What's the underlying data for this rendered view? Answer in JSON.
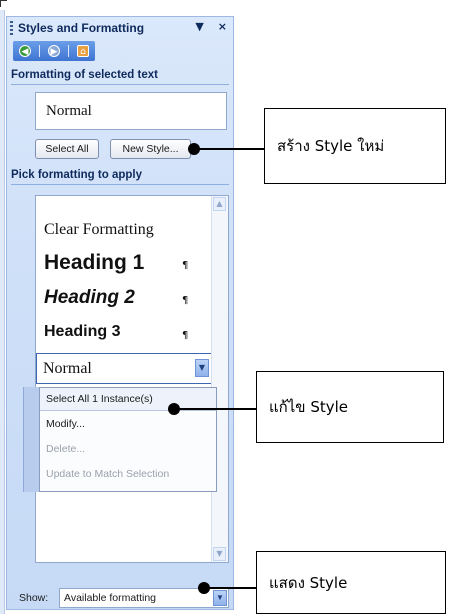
{
  "pane": {
    "title": "Styles and Formatting",
    "title_buttons": [
      "▼",
      "×"
    ],
    "nav_icons": [
      "back-icon",
      "forward-icon",
      "home-icon"
    ]
  },
  "formatting_selected": {
    "heading": "Formatting of selected text",
    "value": "Normal"
  },
  "buttons": {
    "select_all": "Select All",
    "new_style": "New Style..."
  },
  "pick_formatting": {
    "heading": "Pick formatting to apply",
    "items": [
      {
        "label": "Clear Formatting",
        "pilcrow": ""
      },
      {
        "label": "Heading 1",
        "pilcrow": "¶"
      },
      {
        "label": "Heading 2",
        "pilcrow": "¶"
      },
      {
        "label": "Heading 3",
        "pilcrow": "¶"
      },
      {
        "label": "Normal",
        "pilcrow": ""
      }
    ]
  },
  "context_menu": {
    "items": [
      {
        "label": "Select All 1 Instance(s)",
        "disabled": false
      },
      {
        "label": "Modify...",
        "disabled": false
      },
      {
        "label": "Delete...",
        "disabled": true
      },
      {
        "label": "Update to Match Selection",
        "disabled": true
      }
    ]
  },
  "show": {
    "label": "Show:",
    "value": "Available formatting"
  },
  "callouts": {
    "new_style": "สร้าง Style ใหม่",
    "modify": "แก้ไข Style",
    "show": "แสดง Style"
  }
}
